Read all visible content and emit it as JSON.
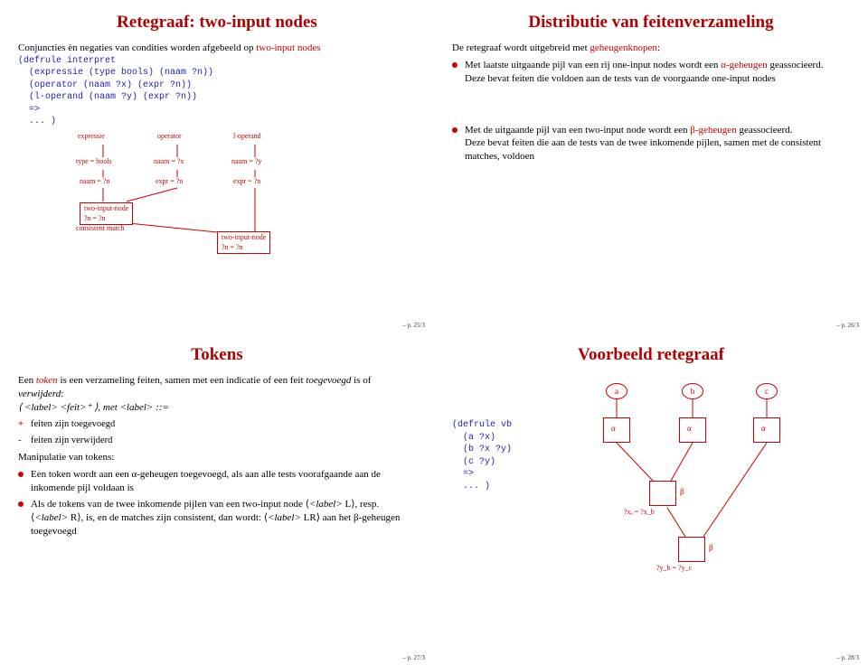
{
  "slide1": {
    "title": "Retegraaf: two-input nodes",
    "intro_a": "Conjuncties èn negaties van condities worden afgebeeld op",
    "intro_b": "two-input nodes",
    "code": "(defrule interpret\n  (expressie (type bools) (naam ?n))\n  (operator (naam ?x) (expr ?n))\n  (l-operand (naam ?y) (expr ?n))\n  =>\n  ... )",
    "dia": {
      "col_a": "expressie",
      "col_b": "operator",
      "col_c": "l-operand",
      "r1a": "type = bools",
      "r1b": "naam = ?x",
      "r1c": "naam = ?y",
      "r2a": "naam = ?n",
      "r2b": "expr = ?n",
      "r2c": "expr = ?n",
      "tin": "two-input-node",
      "eqn": "?n = ?n",
      "cons": "consistent match"
    },
    "pageno": "– p. 25/3"
  },
  "slide2": {
    "title": "Distributie van feitenverzameling",
    "p1a": "De retegraaf wordt uitgebreid met ",
    "p1b": "geheugenknopen",
    "p1c": ":",
    "b1a": "Met laatste uitgaande pijl van een rij one-input nodes wordt een ",
    "b1b": "α",
    "b1c": "-geheugen",
    "b1d": " geassocieerd.",
    "b1e": "Deze bevat feiten die voldoen aan de tests van de voorgaande one-input nodes",
    "b2a": "Met de uitgaande pijl van een two-input node wordt een ",
    "b2b": "β",
    "b2c": "-geheugen",
    "b2d": " geassocieerd.",
    "b2e": "Deze bevat feiten die aan de tests van de twee inkomende pijlen, samen met de consistent matches, voldoen",
    "pageno": "– p. 26/3"
  },
  "slide3": {
    "title": "Tokens",
    "p1a": "Een ",
    "p1b": "token",
    "p1c": " is een verzameling feiten, samen met een indicatie of een feit ",
    "p1d": "toegevoegd",
    "p1e": " is of ",
    "p1f": "verwijderd",
    "p1g": ":",
    "line2": "⟨ <label>  <feit>⁺ ⟩, met <label> ::=",
    "s1": "feiten zijn toegevoegd",
    "s2": "feiten zijn verwijderd",
    "p2": "Manipulatie van tokens:",
    "b1a": "Een token wordt aan een ",
    "b1b": "α",
    "b1c": "-geheugen toegevoegd, als aan alle tests voorafgaande aan de inkomende pijl voldaan is",
    "b2a": "Als de tokens van de twee inkomende pijlen van een two-input node ⟨",
    "b2b": "<label>",
    "b2c": " L⟩, resp. ⟨",
    "b2d": "<label>",
    "b2e": " R⟩, is, en de matches zijn consistent, dan wordt: ⟨",
    "b2f": "<label>",
    "b2g": " LR⟩ aan het ",
    "b2h": "β",
    "b2i": "-geheugen toegevoegd",
    "pageno": "– p. 27/3"
  },
  "slide4": {
    "title": "Voorbeeld retegraaf",
    "code": "(defrule vb\n  (a ?x)\n  (b ?x ?y)\n  (c ?y)\n  =>\n  ... )",
    "dia": {
      "a": "a",
      "b": "b",
      "c": "c",
      "alpha": "α",
      "beta": "β",
      "eq1": "?xₐ = ?x_b",
      "eq2": "?y_b = ?y_c"
    },
    "pageno": "– p. 28/3"
  }
}
